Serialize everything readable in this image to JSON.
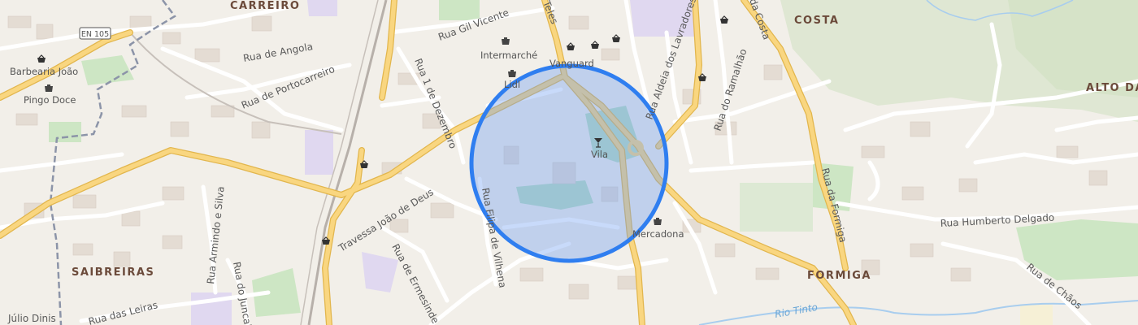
{
  "map": {
    "area_labels": {
      "carreiro": "CARREIRO",
      "costa": "COSTA",
      "alto": "ALTO DA",
      "saibreiras": "SAIBREIRAS",
      "formiga": "FORMIGA"
    },
    "road_shields": {
      "en105": "EN 105"
    },
    "street_labels": {
      "rua_gil_vicente": "Rua Gil Vicente",
      "rua_de_angola": "Rua de Angola",
      "rua_de_portocarreiro": "Rua de Portocarreiro",
      "rua_1_de_dezembro": "Rua 1 de Dezembro",
      "rua_aldeia_dos_lavradores": "Rua Aldeia dos Lavradores",
      "rua_do_ramalhao": "Rua do Ramalhão",
      "rua_da_costa": "da Costa",
      "rua_da_formiga": "Rua da Formiga",
      "rua_humberto_delgado": "Rua Humberto Delgado",
      "rua_de_chaos": "Rua de Chãos",
      "travessa_joao_de_deus": "Travessa João de Deus",
      "rua_de_ermesinde": "Rua de Ermesinde",
      "rua_filipa_de_vilhena": "Rua Filipa de Vilhena",
      "rua_armindo_e_silva": "Rua Armindo e Silva",
      "rua_do_juncal": "Rua do Juncal",
      "rua_das_leiras": "Rua das Leiras",
      "julio_dinis": "Júlio Dinis",
      "rua_teles": "Teles"
    },
    "water_labels": {
      "rio_tinto": "Rio Tinto"
    },
    "pois": {
      "barbearia_joao": "Barbearia João",
      "pingo_doce": "Pingo Doce",
      "intermarche": "Intermarché",
      "vanguard": "Vanguard",
      "lidl": "Lidl",
      "vila": "Vila",
      "mercadona": "Mercadona"
    },
    "colors": {
      "background": "#f2efe9",
      "major_road": "#f9d680",
      "major_road_casing": "#e2b64d",
      "minor_road": "#ffffff",
      "green_area": "#cde6c4",
      "water": "#a8cdee",
      "selection_fill": "#6e9ef2",
      "selection_stroke": "#2f7ef0",
      "boundary": "#8c94a8",
      "purple_area": "#e0d8f0"
    },
    "icons": {
      "shop": "shopping-basket-icon",
      "bar": "cocktail-glass-icon"
    }
  }
}
